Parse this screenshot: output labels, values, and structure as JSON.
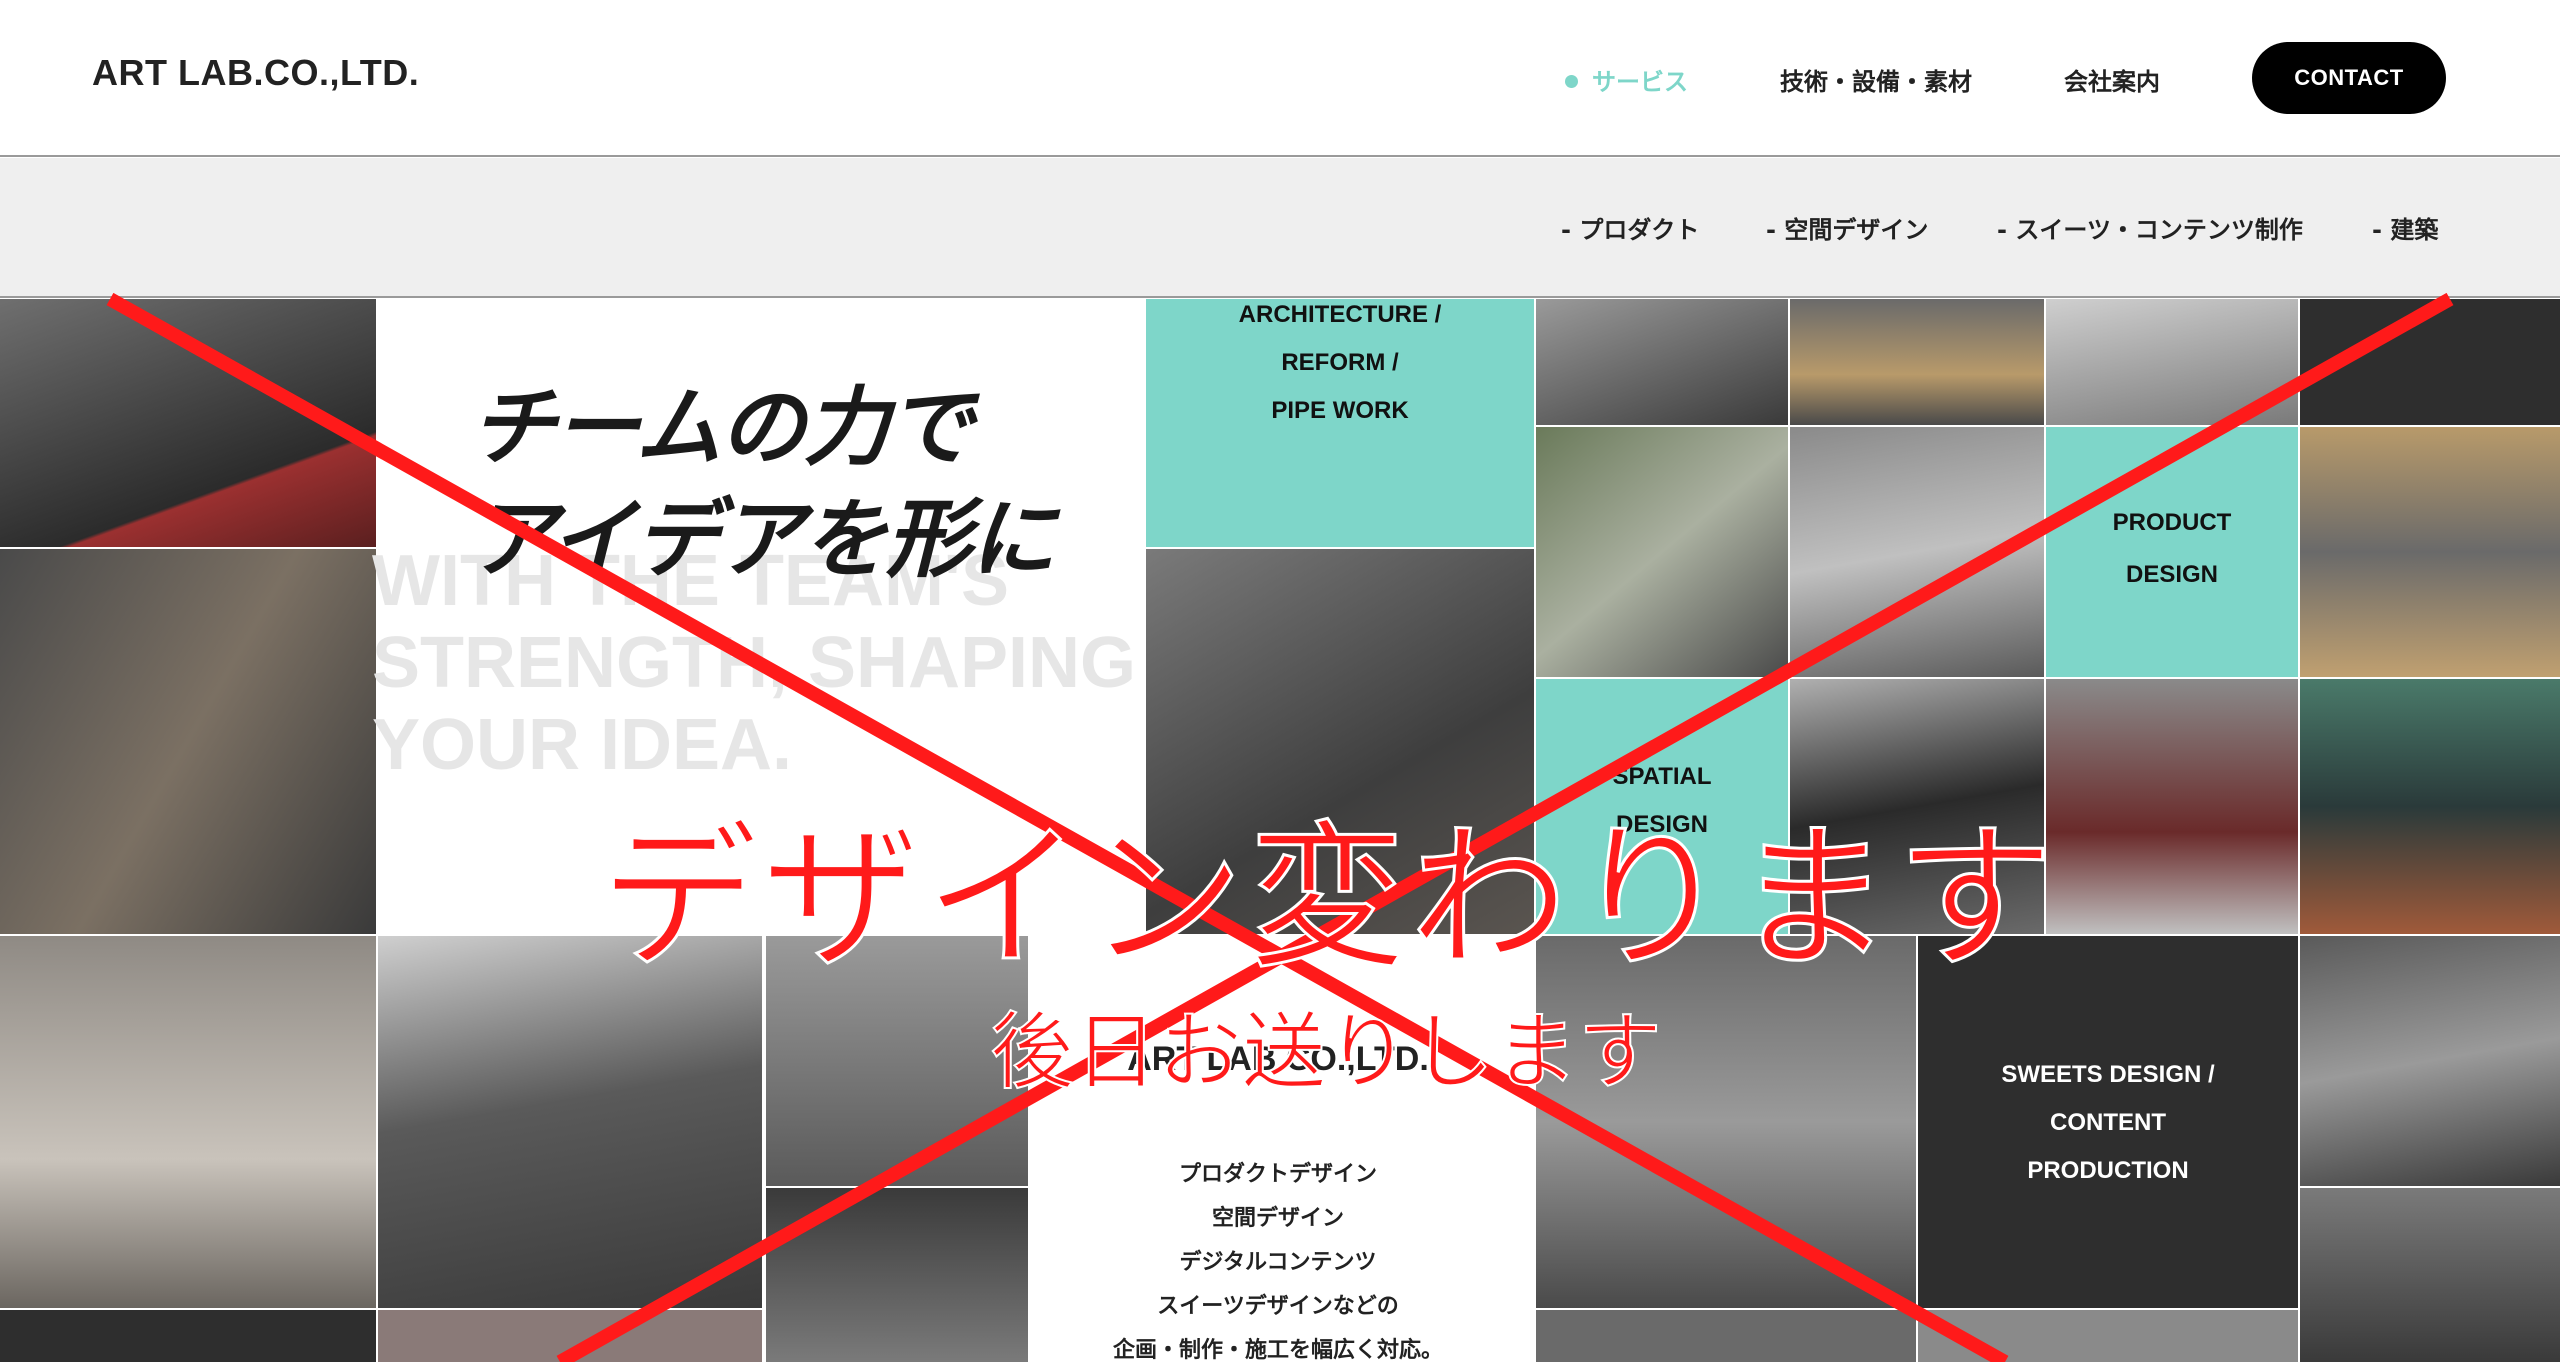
{
  "header": {
    "logo": "ART LAB.CO.,LTD.",
    "nav": {
      "service": "サービス",
      "tech": "技術・設備・素材",
      "company": "会社案内"
    },
    "contact_label": "CONTACT",
    "accent_color": "#7ed6c9"
  },
  "subnav": {
    "items": [
      "- プロダクト",
      "- 空間デザイン",
      "- スイーツ・コンテンツ制作",
      "- 建築"
    ]
  },
  "hero": {
    "title_line1": "チームの力で",
    "title_line2": "アイデアを形に",
    "en_line1": "WITH THE TEAM'S",
    "en_line2": "STRENGTH, SHAPING",
    "en_line3": "YOUR IDEA."
  },
  "tiles": {
    "architecture": [
      "ARCHITECTURE /",
      "REFORM /",
      "PIPE WORK"
    ],
    "product": [
      "PRODUCT",
      "DESIGN"
    ],
    "spatial": [
      "SPATIAL",
      "DESIGN"
    ],
    "sweets": [
      "SWEETS DESIGN /",
      "CONTENT",
      "PRODUCTION"
    ]
  },
  "about": {
    "name": "ART LAB.CO.,LTD.",
    "lines": [
      "プロダクトデザイン",
      "空間デザイン",
      "デジタルコンテンツ",
      "スイーツデザインなどの",
      "企画・制作・施工を幅広く対応。"
    ]
  },
  "overlay": {
    "main": "デザイン変わります",
    "sub": "後日お送りします",
    "color": "#ff1a1a"
  },
  "colors": {
    "teal": "#7ed6c9",
    "dark_tile": "#2e2e2e",
    "subnav_bg": "#efefef"
  }
}
